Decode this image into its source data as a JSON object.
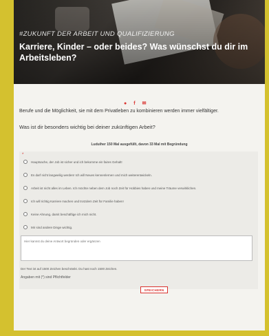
{
  "hero": {
    "eyebrow": "#ZUKUNFT DER ARBEIT UND QUALIFIZIERUNG",
    "title": "Karriere, Kinder – oder beides? Was wünschst du dir im Arbeitsleben?"
  },
  "share_icons": [
    "twitter-icon",
    "facebook-icon",
    "mail-icon"
  ],
  "intro": "Berufe und die Möglichkeit, sie mit dem Privatleben zu kombinieren werden immer vielfältiger.",
  "question": "Was ist dir besonders wichtig bei deiner zukünftigen Arbeit?",
  "survey": {
    "heading": "Luduiher 150 Mal ausgefüllt, davon 33 Mal mit Begründung",
    "required_marker": "*",
    "options": [
      "Hauptsache, der Job ist sicher und ich bekomme ein faires Gehalt!",
      "Es darf nicht langweilig werden! Ich will Neues kennenlernen und mich weiterentwickeln.",
      "Arbeit ist nicht alles im Leben. Ich möchte neben dem Job noch Zeit für Hobbies haben und meine Träume verwirklichen.",
      "Ich will richtig Karriere machen und trotzdem Zeit für Familie haben!",
      "Keine Ahnung, damit beschäftige ich mich nicht.",
      "Mir sind andere Dinge wichtig."
    ],
    "textarea_placeholder": "Hier kannst du deine Antwort begründen oder ergänzen",
    "char_counter": "Der Text ist auf 1500 Zeichen beschränkt. Du hast noch 1500 Zeichen.",
    "required_note": "Angaben mit (*) sind Pflichtfelder",
    "save_label": "SPEICHERN"
  },
  "colors": {
    "accent": "#d9302c",
    "background_outer": "#d4c12f",
    "page": "#f4f3ef"
  }
}
